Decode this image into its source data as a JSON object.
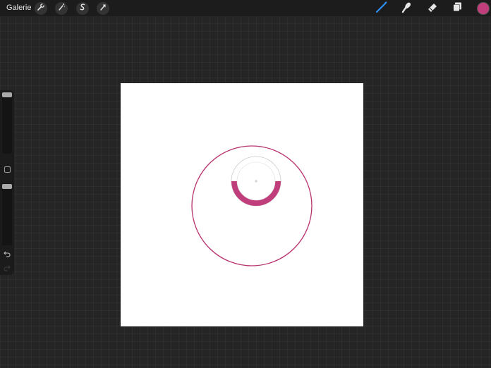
{
  "topbar": {
    "gallery_label": "Galerie",
    "left_tools": [
      {
        "name": "actions",
        "icon": "wrench-icon"
      },
      {
        "name": "adjustments",
        "icon": "magic-wand-icon"
      },
      {
        "name": "selection",
        "icon": "selection-s-icon"
      },
      {
        "name": "transform",
        "icon": "arrow-cursor-icon"
      }
    ],
    "right_tools": [
      {
        "name": "brush",
        "icon": "brush-icon",
        "active": true
      },
      {
        "name": "smudge",
        "icon": "smudge-icon",
        "active": false
      },
      {
        "name": "eraser",
        "icon": "eraser-icon",
        "active": false
      },
      {
        "name": "layers",
        "icon": "layers-icon",
        "active": false
      }
    ],
    "current_color": "#c13e7c"
  },
  "sidebar": {
    "brush_size_level": 1.0,
    "opacity_level": 1.0
  },
  "canvas": {
    "background": "#ffffff",
    "stroke_color": "#b8336f",
    "eyedropper_fill_color": "#c13e7c"
  }
}
